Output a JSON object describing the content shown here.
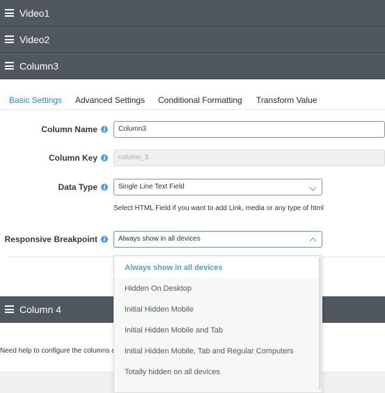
{
  "columns": [
    {
      "label": "Video1"
    },
    {
      "label": "Video2"
    },
    {
      "label": "Column3"
    },
    {
      "label": "Column 4"
    }
  ],
  "tabs": [
    {
      "label": "Basic Settings",
      "active": true
    },
    {
      "label": "Advanced Settings"
    },
    {
      "label": "Conditional Formatting"
    },
    {
      "label": "Transform Value"
    }
  ],
  "fields": {
    "column_name": {
      "label": "Column Name",
      "value": "Column3"
    },
    "column_key": {
      "label": "Column Key",
      "value": "column_3"
    },
    "data_type": {
      "label": "Data Type",
      "value": "Single Line Text Field",
      "help": "Select HTML Field if you want to add Link, media or any type of html"
    },
    "responsive_breakpoint": {
      "label": "Responsive Breakpoint",
      "value": "Always show in all devices"
    }
  },
  "dropdown": {
    "options": [
      "Always show in all devices",
      "Hidden On Desktop",
      "Initial Hidden Mobile",
      "Initial Hidden Mobile and Tab",
      "Initial Hidden Mobile, Tab and Regular Computers",
      "Totally hidden on all devices"
    ],
    "selected_index": 0
  },
  "footer": {
    "help_text": "Need help to configure the columns a"
  },
  "colors": {
    "header_bg": "#50575e",
    "accent": "#1e8cbe",
    "info": "#4a9fd8"
  }
}
